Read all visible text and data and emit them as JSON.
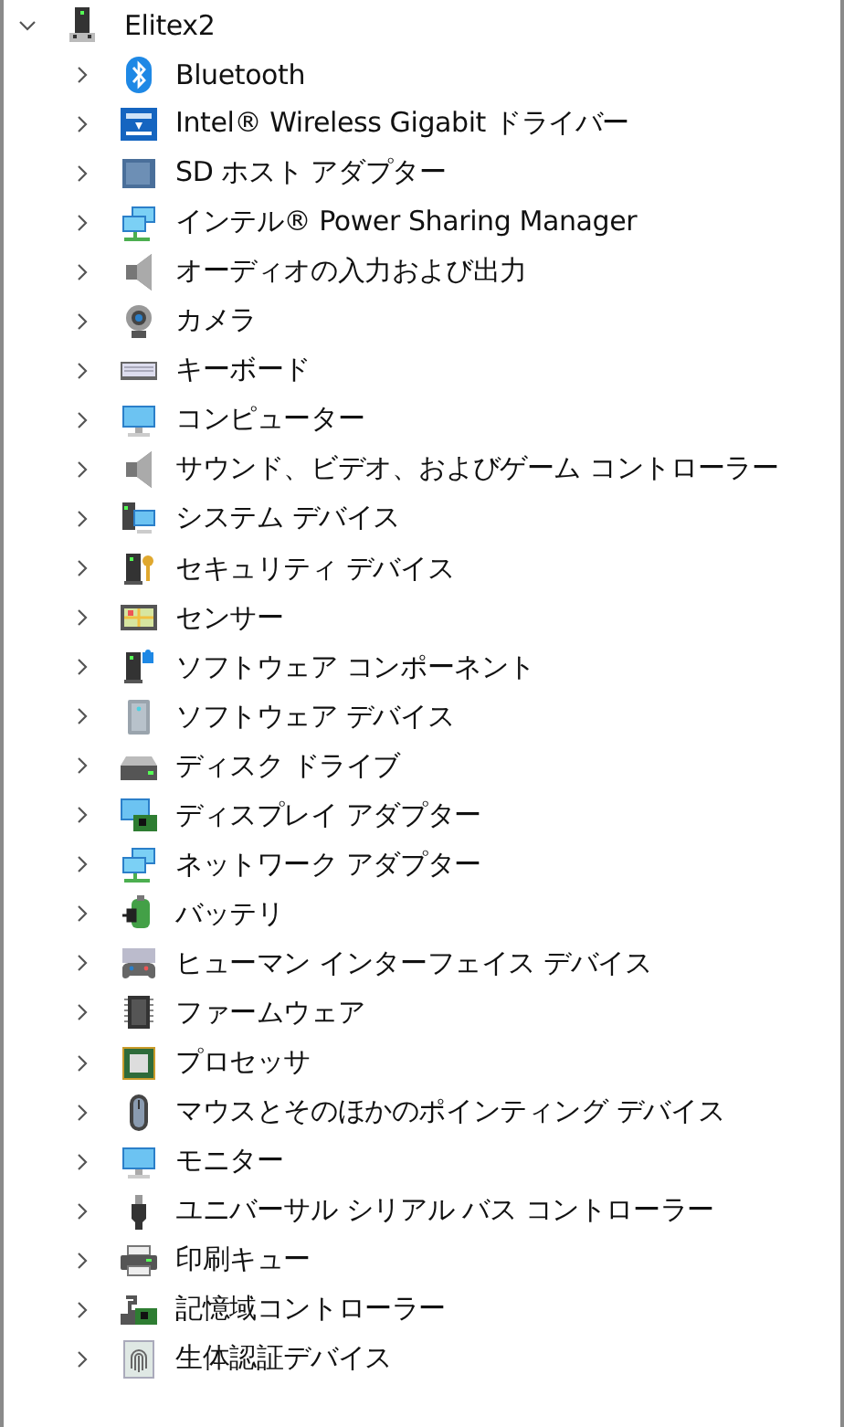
{
  "tree": {
    "label": "Elitex2",
    "expanded": true,
    "children": [
      {
        "label": "Bluetooth",
        "expanded": false
      },
      {
        "label": "Intel® Wireless Gigabit ドライバー",
        "expanded": false
      },
      {
        "label": "SD ホスト アダプター",
        "expanded": false
      },
      {
        "label": "インテル® Power Sharing Manager",
        "expanded": false
      },
      {
        "label": "オーディオの入力および出力",
        "expanded": false
      },
      {
        "label": "カメラ",
        "expanded": false
      },
      {
        "label": "キーボード",
        "expanded": false
      },
      {
        "label": "コンピューター",
        "expanded": false
      },
      {
        "label": "サウンド、ビデオ、およびゲーム コントローラー",
        "expanded": false
      },
      {
        "label": "システム デバイス",
        "expanded": false
      },
      {
        "label": "セキュリティ デバイス",
        "expanded": false
      },
      {
        "label": "センサー",
        "expanded": false
      },
      {
        "label": "ソフトウェア コンポーネント",
        "expanded": false
      },
      {
        "label": "ソフトウェア デバイス",
        "expanded": false
      },
      {
        "label": "ディスク ドライブ",
        "expanded": false
      },
      {
        "label": "ディスプレイ アダプター",
        "expanded": false
      },
      {
        "label": "ネットワーク アダプター",
        "expanded": false
      },
      {
        "label": "バッテリ",
        "expanded": false
      },
      {
        "label": "ヒューマン インターフェイス デバイス",
        "expanded": false
      },
      {
        "label": "ファームウェア",
        "expanded": false
      },
      {
        "label": "プロセッサ",
        "expanded": false
      },
      {
        "label": "マウスとそのほかのポインティング デバイス",
        "expanded": false
      },
      {
        "label": "モニター",
        "expanded": false
      },
      {
        "label": "ユニバーサル シリアル バス コントローラー",
        "expanded": false
      },
      {
        "label": "印刷キュー",
        "expanded": false
      },
      {
        "label": "記憶域コントローラー",
        "expanded": false
      },
      {
        "label": "生体認証デバイス",
        "expanded": false
      }
    ]
  }
}
